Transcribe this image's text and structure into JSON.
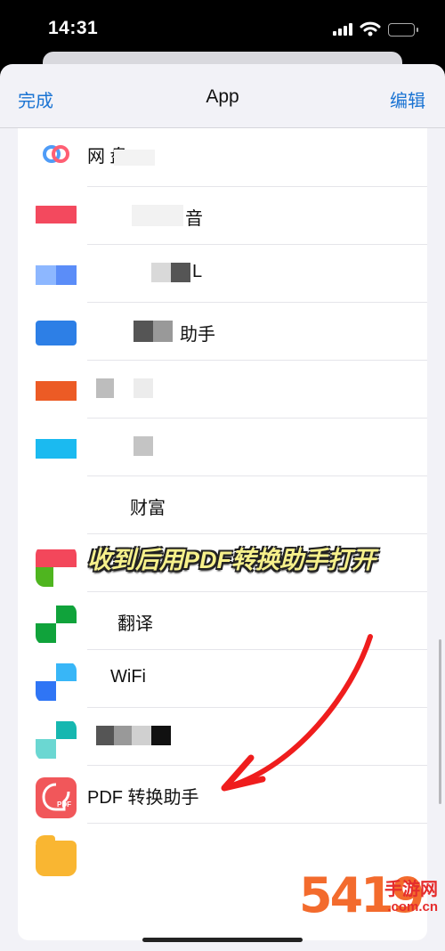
{
  "status_bar": {
    "time": "14:31",
    "icons": [
      "signal-icon",
      "wifi-icon",
      "battery-icon"
    ]
  },
  "nav": {
    "done_label": "完成",
    "title": "App",
    "edit_label": "编辑"
  },
  "apps": [
    {
      "label": "网 盘",
      "icon": "cloud-drive-icon",
      "colors": [
        "#4f9cf7",
        "#ff5f74"
      ]
    },
    {
      "label": "音",
      "icon": "red-app-icon",
      "colors": [
        "#f3495e"
      ]
    },
    {
      "label": "L",
      "icon": "blue-app-icon",
      "colors": [
        "#5b8df8",
        "#8db7ff"
      ]
    },
    {
      "label": "助手",
      "icon": "wallet-app-icon",
      "colors": [
        "#2d7fe6"
      ]
    },
    {
      "label": "",
      "icon": "orange-app-icon",
      "colors": [
        "#ec5b25"
      ]
    },
    {
      "label": "",
      "icon": "cyan-app-icon",
      "colors": [
        "#1bbaf0"
      ]
    },
    {
      "label": "财富",
      "icon": "wealth-app-icon",
      "colors": [
        "#ffffff"
      ]
    },
    {
      "label": "",
      "icon": "red-green-app-icon",
      "colors": [
        "#f3475b",
        "#4fb51f"
      ]
    },
    {
      "label": "翻译",
      "icon": "green-checker-icon",
      "colors": [
        "#10a33b"
      ]
    },
    {
      "label": "WiFi",
      "icon": "wifi-app-icon",
      "colors": [
        "#2f75f5",
        "#38b6f7"
      ]
    },
    {
      "label": "",
      "icon": "teal-app-icon",
      "colors": [
        "#16b7b0",
        "#6bd7d2"
      ]
    },
    {
      "label": "PDF 转换助手",
      "icon": "pdf-converter-icon",
      "colors": [
        "#f1575a"
      ],
      "icon_text": "PDF"
    },
    {
      "label": "",
      "icon": "folder-app-icon",
      "colors": [
        "#f9b632"
      ]
    }
  ],
  "caption": {
    "text": "收到后用PDF转换助手打开",
    "color": "#f6f08b"
  },
  "watermark": {
    "logo": "5419",
    "text": "手游网",
    "domain": ".com.cn"
  },
  "accent_color": "#1b74d3"
}
